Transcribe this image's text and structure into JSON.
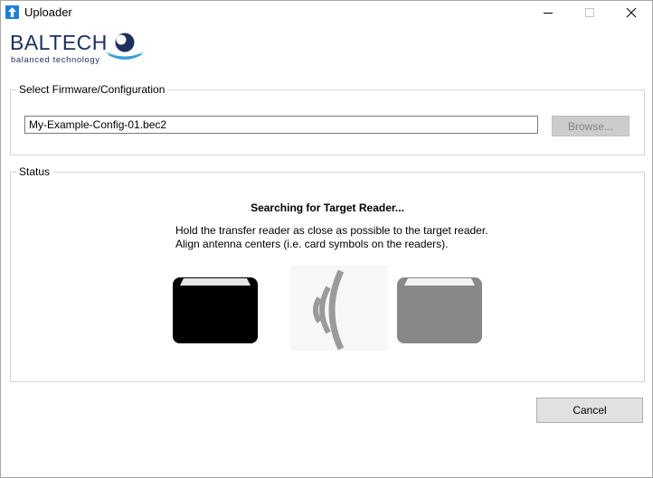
{
  "window": {
    "title": "Uploader",
    "icon": "upload-arrow-icon",
    "accent": "#1e7fd9"
  },
  "logo": {
    "name": "BALTECH",
    "tagline": "balanced technology",
    "color": "#1d2f5e"
  },
  "firmware": {
    "group_label": "Select Firmware/Configuration",
    "file_value": "My-Example-Config-01.bec2",
    "browse_label": "Browse...",
    "browse_enabled": false
  },
  "status": {
    "group_label": "Status",
    "title": "Searching for Target Reader...",
    "line1": "Hold the transfer reader as close as possible to the target reader.",
    "line2": "Align antenna centers (i.e. card symbols on the readers).",
    "transfer_reader_icon": "card-reader-icon",
    "signal_icon": "wireless-signal-icon",
    "target_reader_icon": "card-reader-icon",
    "transfer_color": "#000000",
    "target_color": "#888888"
  },
  "actions": {
    "cancel_label": "Cancel"
  }
}
